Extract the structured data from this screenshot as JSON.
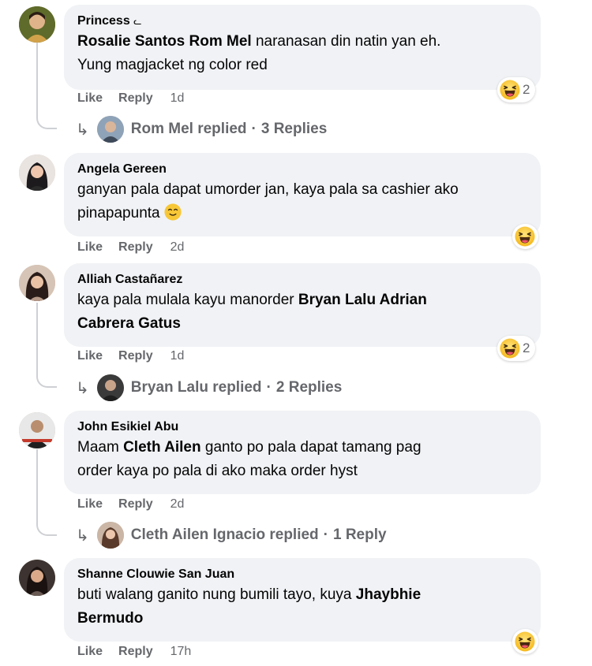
{
  "comments": [
    {
      "author": "Princess",
      "author_mark": "ᓚ",
      "line1_mention": "Rosalie Santos Rom Mel",
      "line1_rest": " naranasan din natin yan eh.",
      "line2": "Yung magjacket ng color red",
      "reaction": {
        "icon": "haha-emoji-icon",
        "count": "2"
      },
      "actions": {
        "like": "Like",
        "reply": "Reply",
        "time": "1d"
      },
      "replies": {
        "name": "Rom Mel replied",
        "dot": "·",
        "count": "3 Replies"
      }
    },
    {
      "author": "Angela Gereen",
      "line1": "ganyan pala dapat umorder jan, kaya pala sa cashier ako",
      "line2": "pinapapunta",
      "line2_emoji": "wink-face-emoji-icon",
      "reaction": {
        "icon": "haha-emoji-icon",
        "count": ""
      },
      "actions": {
        "like": "Like",
        "reply": "Reply",
        "time": "2d"
      }
    },
    {
      "author": "Alliah Castañarez",
      "line1_plain": "kaya pala mulala kayu manorder ",
      "line1_mention": "Bryan Lalu Adrian",
      "line2_mention": "Cabrera Gatus",
      "reaction": {
        "icon": "haha-emoji-icon",
        "count": "2"
      },
      "actions": {
        "like": "Like",
        "reply": "Reply",
        "time": "1d"
      },
      "replies": {
        "name": "Bryan Lalu replied",
        "dot": "·",
        "count": "2 Replies"
      }
    },
    {
      "author": "John Esikiel Abu",
      "line1_plain": "Maam ",
      "line1_mention": "Cleth Ailen",
      "line1_rest": " ganto po pala dapat tamang pag",
      "line2": "order kaya po pala di ako maka order hyst",
      "actions": {
        "like": "Like",
        "reply": "Reply",
        "time": "2d"
      },
      "replies": {
        "name": "Cleth Ailen Ignacio replied",
        "dot": "·",
        "count": "1 Reply"
      }
    },
    {
      "author": "Shanne Clouwie San Juan",
      "line1_plain": "buti walang ganito nung bumili tayo, kuya ",
      "line1_mention": "Jhaybhie",
      "line2_mention": "Bermudo",
      "reaction": {
        "icon": "haha-emoji-icon",
        "count": ""
      },
      "actions": {
        "like": "Like",
        "reply": "Reply",
        "time": "17h"
      }
    }
  ],
  "icons": {
    "reply_arrow": "↳",
    "reply_arrow_name": "reply-arrow-icon"
  },
  "colors": {
    "bubble": "#f0f2f5",
    "secondary_text": "#65676b",
    "haha_yellow": "#f7c737"
  }
}
